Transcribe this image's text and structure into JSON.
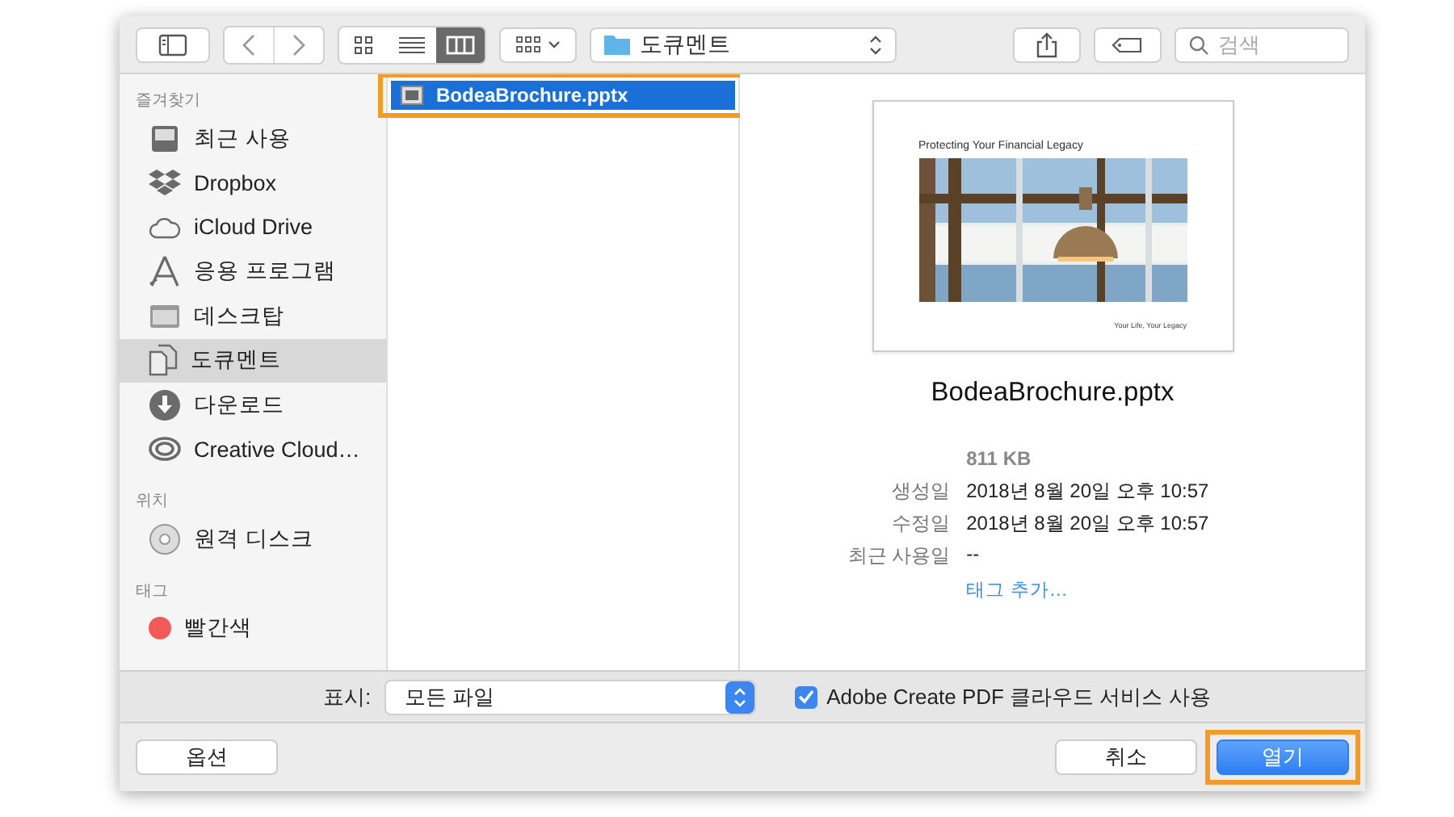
{
  "toolbar": {
    "path": "도큐멘트",
    "search": {
      "placeholder": "검색"
    },
    "view_modes": [
      {
        "kind": "icons",
        "selected": false
      },
      {
        "kind": "list",
        "selected": false
      },
      {
        "kind": "columns",
        "selected": true
      }
    ]
  },
  "sidebar": {
    "sections": [
      {
        "title": "즐겨찾기",
        "items": [
          {
            "label": "최근 사용",
            "kind": "recents",
            "selected": false
          },
          {
            "label": "Dropbox",
            "kind": "dropbox",
            "selected": false
          },
          {
            "label": "iCloud Drive",
            "kind": "cloud",
            "selected": false
          },
          {
            "label": "응용 프로그램",
            "kind": "apps",
            "selected": false
          },
          {
            "label": "데스크탑",
            "kind": "desktop",
            "selected": false
          },
          {
            "label": "도큐멘트",
            "kind": "documents",
            "selected": true
          },
          {
            "label": "다운로드",
            "kind": "downloads",
            "selected": false
          },
          {
            "label": "Creative Cloud…",
            "kind": "creative",
            "selected": false
          }
        ]
      },
      {
        "title": "위치",
        "items": [
          {
            "label": "원격 디스크",
            "kind": "disc",
            "selected": false
          }
        ]
      },
      {
        "title": "태그",
        "items": [
          {
            "label": "빨간색",
            "kind": "tag",
            "color": "#f25a57",
            "selected": false
          }
        ]
      }
    ]
  },
  "files": [
    {
      "name": "BodeaBrochure.pptx",
      "selected": true,
      "highlighted": true
    }
  ],
  "preview": {
    "slide": {
      "title": "Protecting Your Financial Legacy",
      "footer": "Your Life, Your Legacy"
    },
    "name": "BodeaBrochure.pptx",
    "size": "811 KB",
    "info": [
      {
        "label": "생성일",
        "value": "2018년 8월 20일 오후 10:57"
      },
      {
        "label": "수정일",
        "value": "2018년 8월 20일 오후 10:57"
      },
      {
        "label": "최근 사용일",
        "value": "--"
      }
    ],
    "tag_link": "태그 추가…"
  },
  "options": {
    "show_label": "표시:",
    "format": "모든 파일",
    "checkbox": {
      "label": "Adobe Create PDF 클라우드 서비스 사용",
      "checked": true
    }
  },
  "buttons": [
    {
      "label": "옵션",
      "kind": "secondary",
      "highlighted": false
    },
    {
      "label": "취소",
      "kind": "secondary",
      "highlighted": false
    },
    {
      "label": "열기",
      "kind": "primary",
      "highlighted": true
    }
  ]
}
